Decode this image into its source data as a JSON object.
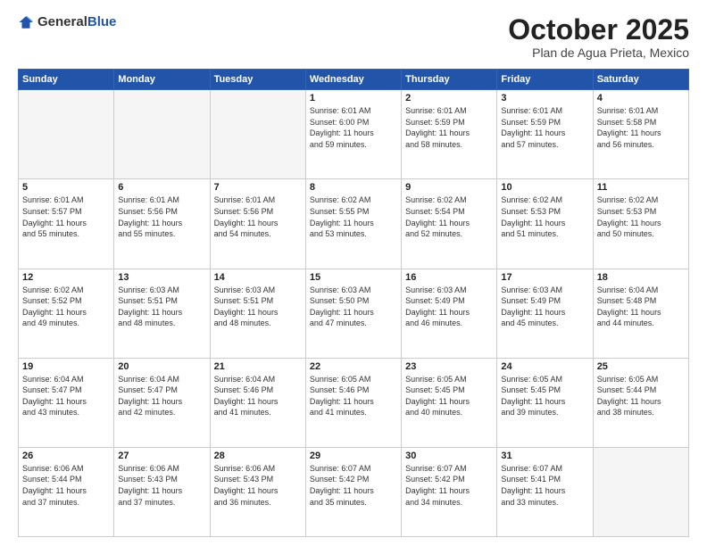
{
  "header": {
    "logo": {
      "general": "General",
      "blue": "Blue"
    },
    "month": "October 2025",
    "location": "Plan de Agua Prieta, Mexico"
  },
  "weekdays": [
    "Sunday",
    "Monday",
    "Tuesday",
    "Wednesday",
    "Thursday",
    "Friday",
    "Saturday"
  ],
  "weeks": [
    [
      {
        "day": "",
        "info": ""
      },
      {
        "day": "",
        "info": ""
      },
      {
        "day": "",
        "info": ""
      },
      {
        "day": "1",
        "info": "Sunrise: 6:01 AM\nSunset: 6:00 PM\nDaylight: 11 hours\nand 59 minutes."
      },
      {
        "day": "2",
        "info": "Sunrise: 6:01 AM\nSunset: 5:59 PM\nDaylight: 11 hours\nand 58 minutes."
      },
      {
        "day": "3",
        "info": "Sunrise: 6:01 AM\nSunset: 5:59 PM\nDaylight: 11 hours\nand 57 minutes."
      },
      {
        "day": "4",
        "info": "Sunrise: 6:01 AM\nSunset: 5:58 PM\nDaylight: 11 hours\nand 56 minutes."
      }
    ],
    [
      {
        "day": "5",
        "info": "Sunrise: 6:01 AM\nSunset: 5:57 PM\nDaylight: 11 hours\nand 55 minutes."
      },
      {
        "day": "6",
        "info": "Sunrise: 6:01 AM\nSunset: 5:56 PM\nDaylight: 11 hours\nand 55 minutes."
      },
      {
        "day": "7",
        "info": "Sunrise: 6:01 AM\nSunset: 5:56 PM\nDaylight: 11 hours\nand 54 minutes."
      },
      {
        "day": "8",
        "info": "Sunrise: 6:02 AM\nSunset: 5:55 PM\nDaylight: 11 hours\nand 53 minutes."
      },
      {
        "day": "9",
        "info": "Sunrise: 6:02 AM\nSunset: 5:54 PM\nDaylight: 11 hours\nand 52 minutes."
      },
      {
        "day": "10",
        "info": "Sunrise: 6:02 AM\nSunset: 5:53 PM\nDaylight: 11 hours\nand 51 minutes."
      },
      {
        "day": "11",
        "info": "Sunrise: 6:02 AM\nSunset: 5:53 PM\nDaylight: 11 hours\nand 50 minutes."
      }
    ],
    [
      {
        "day": "12",
        "info": "Sunrise: 6:02 AM\nSunset: 5:52 PM\nDaylight: 11 hours\nand 49 minutes."
      },
      {
        "day": "13",
        "info": "Sunrise: 6:03 AM\nSunset: 5:51 PM\nDaylight: 11 hours\nand 48 minutes."
      },
      {
        "day": "14",
        "info": "Sunrise: 6:03 AM\nSunset: 5:51 PM\nDaylight: 11 hours\nand 48 minutes."
      },
      {
        "day": "15",
        "info": "Sunrise: 6:03 AM\nSunset: 5:50 PM\nDaylight: 11 hours\nand 47 minutes."
      },
      {
        "day": "16",
        "info": "Sunrise: 6:03 AM\nSunset: 5:49 PM\nDaylight: 11 hours\nand 46 minutes."
      },
      {
        "day": "17",
        "info": "Sunrise: 6:03 AM\nSunset: 5:49 PM\nDaylight: 11 hours\nand 45 minutes."
      },
      {
        "day": "18",
        "info": "Sunrise: 6:04 AM\nSunset: 5:48 PM\nDaylight: 11 hours\nand 44 minutes."
      }
    ],
    [
      {
        "day": "19",
        "info": "Sunrise: 6:04 AM\nSunset: 5:47 PM\nDaylight: 11 hours\nand 43 minutes."
      },
      {
        "day": "20",
        "info": "Sunrise: 6:04 AM\nSunset: 5:47 PM\nDaylight: 11 hours\nand 42 minutes."
      },
      {
        "day": "21",
        "info": "Sunrise: 6:04 AM\nSunset: 5:46 PM\nDaylight: 11 hours\nand 41 minutes."
      },
      {
        "day": "22",
        "info": "Sunrise: 6:05 AM\nSunset: 5:46 PM\nDaylight: 11 hours\nand 41 minutes."
      },
      {
        "day": "23",
        "info": "Sunrise: 6:05 AM\nSunset: 5:45 PM\nDaylight: 11 hours\nand 40 minutes."
      },
      {
        "day": "24",
        "info": "Sunrise: 6:05 AM\nSunset: 5:45 PM\nDaylight: 11 hours\nand 39 minutes."
      },
      {
        "day": "25",
        "info": "Sunrise: 6:05 AM\nSunset: 5:44 PM\nDaylight: 11 hours\nand 38 minutes."
      }
    ],
    [
      {
        "day": "26",
        "info": "Sunrise: 6:06 AM\nSunset: 5:44 PM\nDaylight: 11 hours\nand 37 minutes."
      },
      {
        "day": "27",
        "info": "Sunrise: 6:06 AM\nSunset: 5:43 PM\nDaylight: 11 hours\nand 37 minutes."
      },
      {
        "day": "28",
        "info": "Sunrise: 6:06 AM\nSunset: 5:43 PM\nDaylight: 11 hours\nand 36 minutes."
      },
      {
        "day": "29",
        "info": "Sunrise: 6:07 AM\nSunset: 5:42 PM\nDaylight: 11 hours\nand 35 minutes."
      },
      {
        "day": "30",
        "info": "Sunrise: 6:07 AM\nSunset: 5:42 PM\nDaylight: 11 hours\nand 34 minutes."
      },
      {
        "day": "31",
        "info": "Sunrise: 6:07 AM\nSunset: 5:41 PM\nDaylight: 11 hours\nand 33 minutes."
      },
      {
        "day": "",
        "info": ""
      }
    ]
  ]
}
